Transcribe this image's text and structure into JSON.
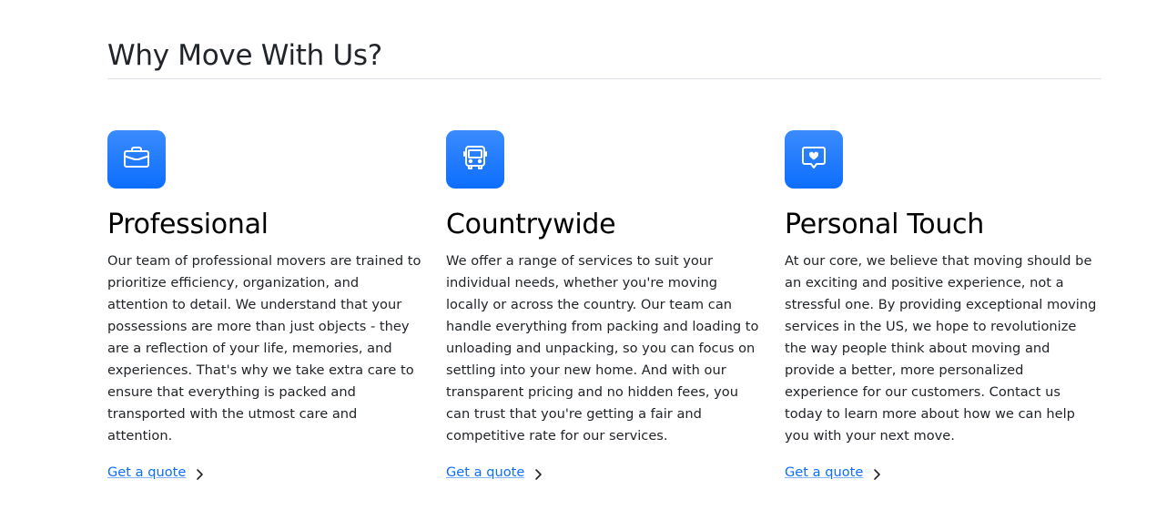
{
  "page_title": "Why Move With Us?",
  "features": [
    {
      "icon": "briefcase-icon",
      "title": "Professional",
      "text": "Our team of professional movers are trained to prioritize efficiency, organization, and attention to detail. We understand that your possessions are more than just objects - they are a reflection of your life, memories, and experiences. That's why we take extra care to ensure that everything is packed and transported with the utmost care and attention.",
      "link_label": "Get a quote"
    },
    {
      "icon": "bus-icon",
      "title": "Countrywide",
      "text": "We offer a range of services to suit your individual needs, whether you're moving locally or across the country. Our team can handle everything from packing and loading to unloading and unpacking, so you can focus on settling into your new home. And with our transparent pricing and no hidden fees, you can trust that you're getting a fair and competitive rate for our services.",
      "link_label": "Get a quote"
    },
    {
      "icon": "chat-heart-icon",
      "title": "Personal Touch",
      "text": "At our core, we believe that moving should be an exciting and positive experience, not a stressful one. By providing exceptional moving services in the US, we hope to revolutionize the way people think about moving and provide a better, more personalized experience for our customers. Contact us today to learn more about how we can help you with your next move.",
      "link_label": "Get a quote"
    }
  ],
  "colors": {
    "accent": "#0d6efd",
    "text": "#212529",
    "divider": "#dee2e6"
  }
}
